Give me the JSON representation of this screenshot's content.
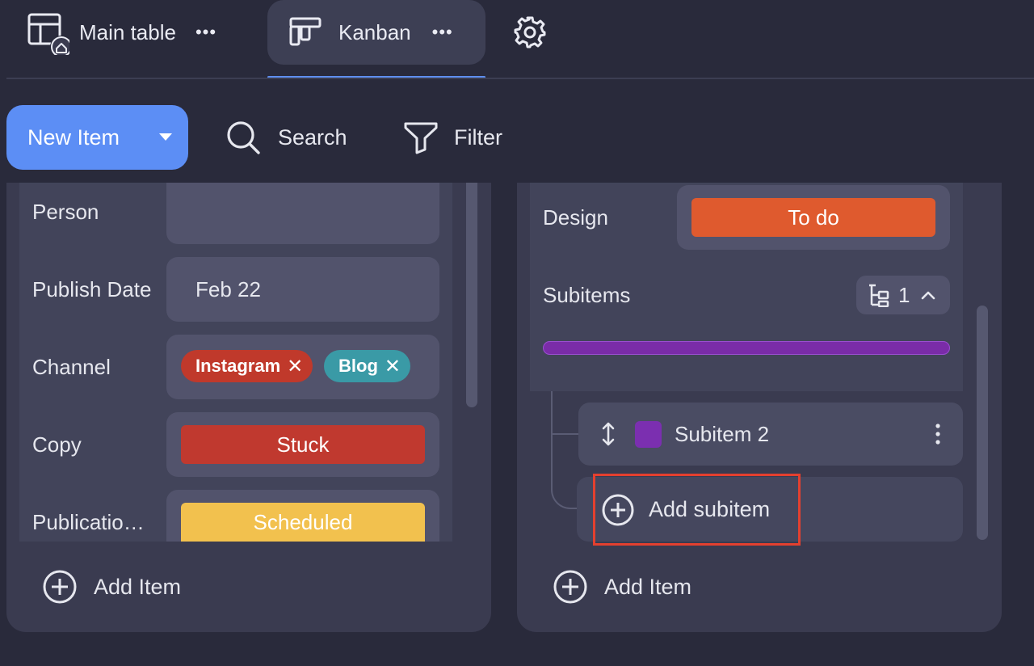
{
  "tabs": {
    "main_table": {
      "label": "Main table"
    },
    "kanban": {
      "label": "Kanban"
    },
    "more_label": "•••"
  },
  "toolbar": {
    "new_item_label": "New Item",
    "search_label": "Search",
    "filter_label": "Filter"
  },
  "left_card": {
    "fields": [
      {
        "label": "Person",
        "value": ""
      },
      {
        "label": "Publish Date",
        "value": "Feb 22"
      },
      {
        "label": "Channel",
        "chips": [
          {
            "label": "Instagram",
            "color": "#c0392b"
          },
          {
            "label": "Blog",
            "color": "#3a9aa6"
          }
        ]
      },
      {
        "label": "Copy",
        "status": "Stuck",
        "color": "#c0392f"
      },
      {
        "label": "Publicatio…",
        "status": "Scheduled",
        "color": "#f2c14e"
      }
    ],
    "add_item_label": "Add Item"
  },
  "right_card": {
    "design_label": "Design",
    "design_status": "To do",
    "design_color": "#df5a2e",
    "subitems_label": "Subitems",
    "subitems_count": "1",
    "subitem": {
      "name": "Subitem 2",
      "color": "#7b2fb0"
    },
    "add_subitem_label": "Add subitem",
    "add_item_label": "Add Item"
  },
  "colors": {
    "background": "#292a3b",
    "panel": "#3a3b50",
    "accent": "#5c8ef5",
    "highlight": "#e4402f"
  }
}
